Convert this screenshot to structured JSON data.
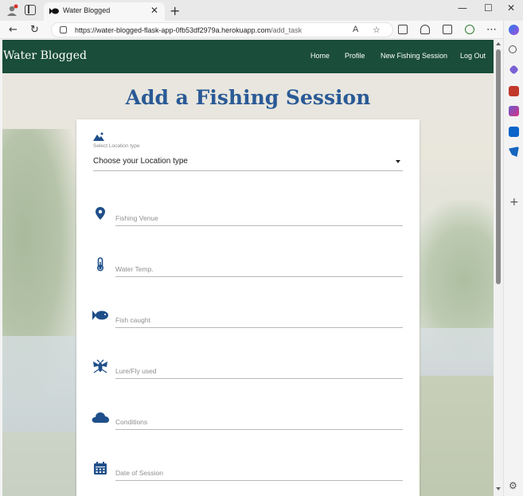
{
  "browser": {
    "tab_title": "Water Blogged",
    "new_tab": "+",
    "close_tab": "✕",
    "url_host": "https://water-blogged-flask-app-0fb53df2979a.herokuapp.com",
    "url_path": "/add_task",
    "window_controls": [
      "—",
      "☐",
      "✕"
    ]
  },
  "navbar": {
    "brand": "Water Blogged",
    "links": [
      "Home",
      "Profile",
      "New Fishing Session",
      "Log Out"
    ],
    "color": "#1a4d3a"
  },
  "page": {
    "title": "Add a Fishing Session",
    "title_color": "#2a5a96"
  },
  "form": {
    "location_label": "Select Location type",
    "location_value": "Choose your Location type",
    "fields": [
      {
        "placeholder": "Fishing Venue",
        "icon": "map-marker-icon"
      },
      {
        "placeholder": "Water Temp.",
        "icon": "thermometer-icon"
      },
      {
        "placeholder": "Fish caught",
        "icon": "fish-icon"
      },
      {
        "placeholder": "Lure/Fly used",
        "icon": "bug-icon"
      },
      {
        "placeholder": "Conditions",
        "icon": "cloud-icon"
      },
      {
        "placeholder": "Date of Session",
        "icon": "calendar-icon"
      }
    ],
    "icon_color": "#1f4f8a"
  }
}
